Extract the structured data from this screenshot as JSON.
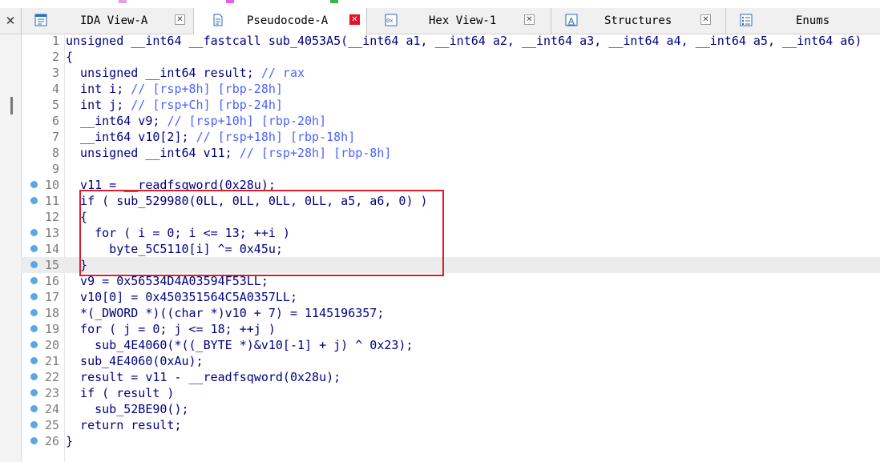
{
  "colors": {
    "keyword": "#000080",
    "comment": "#4a64ff",
    "line_number": "#7a7a7a",
    "breakpoint": "#5aa7e3",
    "annotation_box": "#d9202a",
    "active_tab_close": "#e81123"
  },
  "tabs": [
    {
      "label": "IDA View-A",
      "icon": "graph-view-icon",
      "active": false
    },
    {
      "label": "Pseudocode-A",
      "icon": "pseudocode-icon",
      "active": true
    },
    {
      "label": "Hex View-1",
      "icon": "hex-view-icon",
      "active": false
    },
    {
      "label": "Structures",
      "icon": "structures-icon",
      "active": false
    },
    {
      "label": "Enums",
      "icon": "enums-icon",
      "active": false
    }
  ],
  "pane_close": "✕",
  "tab_close": "✕",
  "code_lines": [
    {
      "n": "1",
      "bp": false,
      "text": "unsigned __int64 __fastcall sub_4053A5(__int64 a1, __int64 a2, __int64 a3, __int64 a4, __int64 a5, __int64 a6)",
      "comment": ""
    },
    {
      "n": "2",
      "bp": false,
      "text": "{",
      "comment": ""
    },
    {
      "n": "3",
      "bp": false,
      "text": "  unsigned __int64 result; ",
      "comment": "// rax"
    },
    {
      "n": "4",
      "bp": false,
      "text": "  int i; ",
      "comment": "// [rsp+8h] [rbp-28h]"
    },
    {
      "n": "5",
      "bp": false,
      "text": "  int j; ",
      "comment": "// [rsp+Ch] [rbp-24h]"
    },
    {
      "n": "6",
      "bp": false,
      "text": "  __int64 v9; ",
      "comment": "// [rsp+10h] [rbp-20h]"
    },
    {
      "n": "7",
      "bp": false,
      "text": "  __int64 v10[2]; ",
      "comment": "// [rsp+18h] [rbp-18h]"
    },
    {
      "n": "8",
      "bp": false,
      "text": "  unsigned __int64 v11; ",
      "comment": "// [rsp+28h] [rbp-8h]"
    },
    {
      "n": "9",
      "bp": false,
      "text": "",
      "comment": ""
    },
    {
      "n": "10",
      "bp": true,
      "text": "  v11 = __readfsqword(0x28u);",
      "comment": ""
    },
    {
      "n": "11",
      "bp": true,
      "text": "  if ( sub_529980(0LL, 0LL, 0LL, 0LL, a5, a6, 0) )",
      "comment": ""
    },
    {
      "n": "12",
      "bp": false,
      "text": "  {",
      "comment": ""
    },
    {
      "n": "13",
      "bp": true,
      "text": "    for ( i = 0; i <= 13; ++i )",
      "comment": ""
    },
    {
      "n": "14",
      "bp": true,
      "text": "      byte_5C5110[i] ^= 0x45u;",
      "comment": ""
    },
    {
      "n": "15",
      "bp": true,
      "text": "  }",
      "comment": ""
    },
    {
      "n": "16",
      "bp": true,
      "text": "  v9 = 0x56534D4A03594F53LL;",
      "comment": ""
    },
    {
      "n": "17",
      "bp": true,
      "text": "  v10[0] = 0x450351564C5A0357LL;",
      "comment": ""
    },
    {
      "n": "18",
      "bp": true,
      "text": "  *(_DWORD *)((char *)v10 + 7) = 1145196357;",
      "comment": ""
    },
    {
      "n": "19",
      "bp": true,
      "text": "  for ( j = 0; j <= 18; ++j )",
      "comment": ""
    },
    {
      "n": "20",
      "bp": true,
      "text": "    sub_4E4060(*((_BYTE *)&v10[-1] + j) ^ 0x23);",
      "comment": ""
    },
    {
      "n": "21",
      "bp": true,
      "text": "  sub_4E4060(0xAu);",
      "comment": ""
    },
    {
      "n": "22",
      "bp": true,
      "text": "  result = v11 - __readfsqword(0x28u);",
      "comment": ""
    },
    {
      "n": "23",
      "bp": true,
      "text": "  if ( result )",
      "comment": ""
    },
    {
      "n": "24",
      "bp": true,
      "text": "    sub_52BE90();",
      "comment": ""
    },
    {
      "n": "25",
      "bp": true,
      "text": "  return result;",
      "comment": ""
    },
    {
      "n": "26",
      "bp": true,
      "text": "}",
      "comment": ""
    }
  ],
  "current_line": "15"
}
